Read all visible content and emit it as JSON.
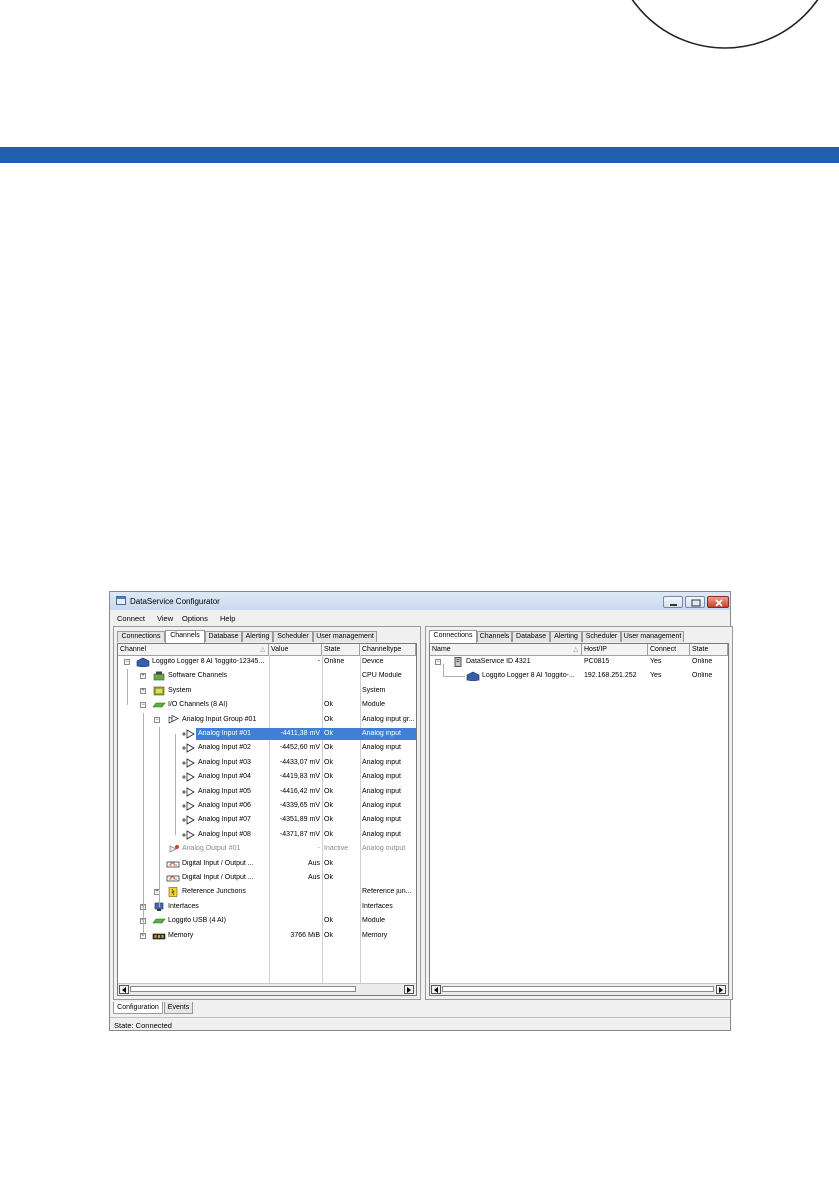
{
  "window": {
    "title": "DataService Configurator",
    "menu": [
      "Connect",
      "View",
      "Options",
      "Help"
    ]
  },
  "left_pane": {
    "tabs": [
      "Connections",
      "Channels",
      "Database",
      "Alerting",
      "Scheduler",
      "User management"
    ],
    "active_tab": "Channels",
    "columns": [
      "Channel",
      "Value",
      "State",
      "Channeltype"
    ],
    "rows": [
      {
        "name": "Loggito Logger 8 AI 'loggito-12345...",
        "value": "-",
        "state": "Online",
        "type": "Device",
        "icon": "device-icon"
      },
      {
        "name": "Software Channels",
        "value": "",
        "state": "",
        "type": "CPU Module",
        "icon": "cpu-icon"
      },
      {
        "name": "System",
        "value": "",
        "state": "",
        "type": "System",
        "icon": "system-icon"
      },
      {
        "name": "I/O Channels (8 AI)",
        "value": "",
        "state": "Ok",
        "type": "Module",
        "icon": "module-icon"
      },
      {
        "name": "Analog Input Group #01",
        "value": "",
        "state": "Ok",
        "type": "Analog input gr...",
        "icon": "input-group-icon"
      },
      {
        "name": "Analog Input #01",
        "value": "-4411,38 mV",
        "state": "Ok",
        "type": "Analog input",
        "icon": "analog-input-icon"
      },
      {
        "name": "Analog Input #02",
        "value": "-4452,60 mV",
        "state": "Ok",
        "type": "Analog input",
        "icon": "analog-input-icon"
      },
      {
        "name": "Analog Input #03",
        "value": "-4433,07 mV",
        "state": "Ok",
        "type": "Analog input",
        "icon": "analog-input-icon"
      },
      {
        "name": "Analog Input #04",
        "value": "-4419,83 mV",
        "state": "Ok",
        "type": "Analog input",
        "icon": "analog-input-icon"
      },
      {
        "name": "Analog Input #05",
        "value": "-4416,42 mV",
        "state": "Ok",
        "type": "Analog input",
        "icon": "analog-input-icon"
      },
      {
        "name": "Analog Input #06",
        "value": "-4339,65 mV",
        "state": "Ok",
        "type": "Analog input",
        "icon": "analog-input-icon"
      },
      {
        "name": "Analog Input #07",
        "value": "-4351,89 mV",
        "state": "Ok",
        "type": "Analog input",
        "icon": "analog-input-icon"
      },
      {
        "name": "Analog Input #08",
        "value": "-4371,87 mV",
        "state": "Ok",
        "type": "Analog input",
        "icon": "analog-input-icon"
      },
      {
        "name": "Analog Output #01",
        "value": "-",
        "state": "Inactive",
        "type": "Analog output",
        "icon": "analog-output-icon"
      },
      {
        "name": "Digital Input / Output ...",
        "value": "Aus",
        "state": "Ok",
        "type": "",
        "icon": "digital-io-icon"
      },
      {
        "name": "Digital Input / Output ...",
        "value": "Aus",
        "state": "Ok",
        "type": "",
        "icon": "digital-io-icon"
      },
      {
        "name": "Reference Junctions",
        "value": "",
        "state": "",
        "type": "Reference jun...",
        "icon": "reference-junction-icon"
      },
      {
        "name": "Interfaces",
        "value": "",
        "state": "",
        "type": "Interfaces",
        "icon": "interfaces-icon"
      },
      {
        "name": "Loggito USB (4 AI)",
        "value": "",
        "state": "Ok",
        "type": "Module",
        "icon": "module-icon"
      },
      {
        "name": "Memory",
        "value": "3766 MiB",
        "state": "Ok",
        "type": "Memory",
        "icon": "memory-icon"
      }
    ]
  },
  "right_pane": {
    "tabs": [
      "Connections",
      "Channels",
      "Database",
      "Alerting",
      "Scheduler",
      "User management"
    ],
    "active_tab": "Connections",
    "columns": [
      "Name",
      "Host/IP",
      "Connect",
      "State"
    ],
    "rows": [
      {
        "name": "DataService ID 4321",
        "host": "PC0815",
        "connect": "Yes",
        "state": "Online",
        "icon": "server-icon"
      },
      {
        "name": "Loggito Logger 8 AI 'loggito-...",
        "host": "192.168.251.252",
        "connect": "Yes",
        "state": "Online",
        "icon": "device-icon"
      }
    ]
  },
  "bottom_tabs": [
    "Configuration",
    "Events"
  ],
  "status": "State: Connected",
  "colors": {
    "band": "#1f5fb0",
    "selection": "#3f7fd6"
  }
}
